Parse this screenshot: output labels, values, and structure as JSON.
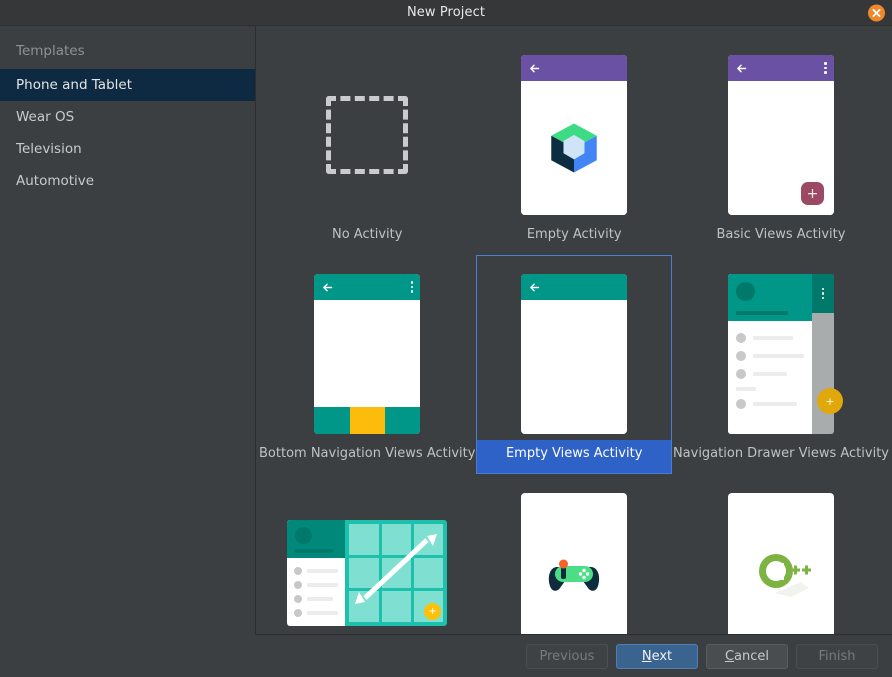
{
  "window": {
    "title": "New Project",
    "close_icon": "close-icon"
  },
  "sidebar": {
    "header": "Templates",
    "items": [
      {
        "label": "Phone and Tablet",
        "selected": true
      },
      {
        "label": "Wear OS",
        "selected": false
      },
      {
        "label": "Television",
        "selected": false
      },
      {
        "label": "Automotive",
        "selected": false
      }
    ]
  },
  "templates": [
    {
      "label": "No Activity",
      "selected": false,
      "thumb": "dashed-placeholder"
    },
    {
      "label": "Empty Activity",
      "selected": false,
      "thumb": "compose-phone"
    },
    {
      "label": "Basic Views Activity",
      "selected": false,
      "thumb": "purple-phone-fab"
    },
    {
      "label": "Bottom Navigation Views Activity",
      "selected": false,
      "thumb": "teal-phone-bottomnav"
    },
    {
      "label": "Empty Views Activity",
      "selected": true,
      "thumb": "teal-phone-empty"
    },
    {
      "label": "Navigation Drawer Views Activity",
      "selected": false,
      "thumb": "nav-drawer-phone"
    },
    {
      "label": "",
      "selected": false,
      "thumb": "responsive-tablet"
    },
    {
      "label": "",
      "selected": false,
      "thumb": "game-controller"
    },
    {
      "label": "",
      "selected": false,
      "thumb": "cpp-logo"
    }
  ],
  "footer": {
    "previous": {
      "label": "Previous",
      "enabled": false
    },
    "next": {
      "label": "Next",
      "enabled": true,
      "mnemonic": "N",
      "primary": true
    },
    "cancel": {
      "label": "Cancel",
      "enabled": true,
      "mnemonic": "C"
    },
    "finish": {
      "label": "Finish",
      "enabled": false
    }
  },
  "fab_labels": {
    "plus": "+"
  },
  "colors": {
    "window_bg": "#3c3f41",
    "titlebar_bg": "#353739",
    "close_button": "#f0882b",
    "sidebar_selected": "#0d2a42",
    "selection_blue": "#2f62c6",
    "selection_border": "#4a7dd6",
    "primary_button": "#3b638f",
    "appbar_purple": "#6a51a3",
    "appbar_teal": "#009688",
    "accent_yellow": "#fdbc0c",
    "fab_mauve": "#9c4a63",
    "compose_green": "#3ddc84",
    "compose_blue": "#4285f4",
    "compose_navy": "#0d2e40",
    "cpp_green": "#7cb342"
  }
}
